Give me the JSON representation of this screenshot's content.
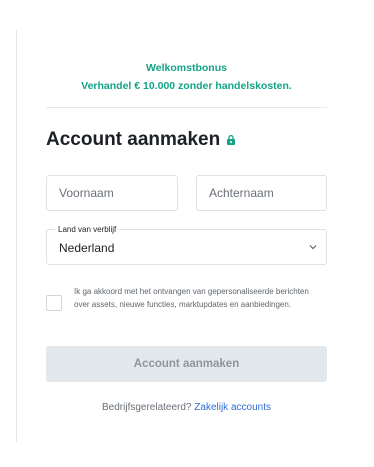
{
  "bonus": {
    "title": "Welkomstbonus",
    "text": "Verhandel € 10.000 zonder handelskosten."
  },
  "heading": {
    "title": "Account aanmaken",
    "icon": "lock-icon"
  },
  "form": {
    "first_name_placeholder": "Voornaam",
    "last_name_placeholder": "Achternaam",
    "country_label": "Land van verblijf",
    "country_value": "Nederland",
    "consent_text": "Ik ga akkoord met het ontvangen van gepersonaliseerde berichten over assets, nieuwe functies, marktupdates en aanbiedingen.",
    "consent_checked": false,
    "submit_label": "Account aanmaken"
  },
  "footer": {
    "question": "Bedrijfsgerelateerd?",
    "link_label": "Zakelijk accounts"
  },
  "colors": {
    "accent": "#13a386",
    "link": "#2f6ed8",
    "disabled_button": "#e3e8ec"
  }
}
